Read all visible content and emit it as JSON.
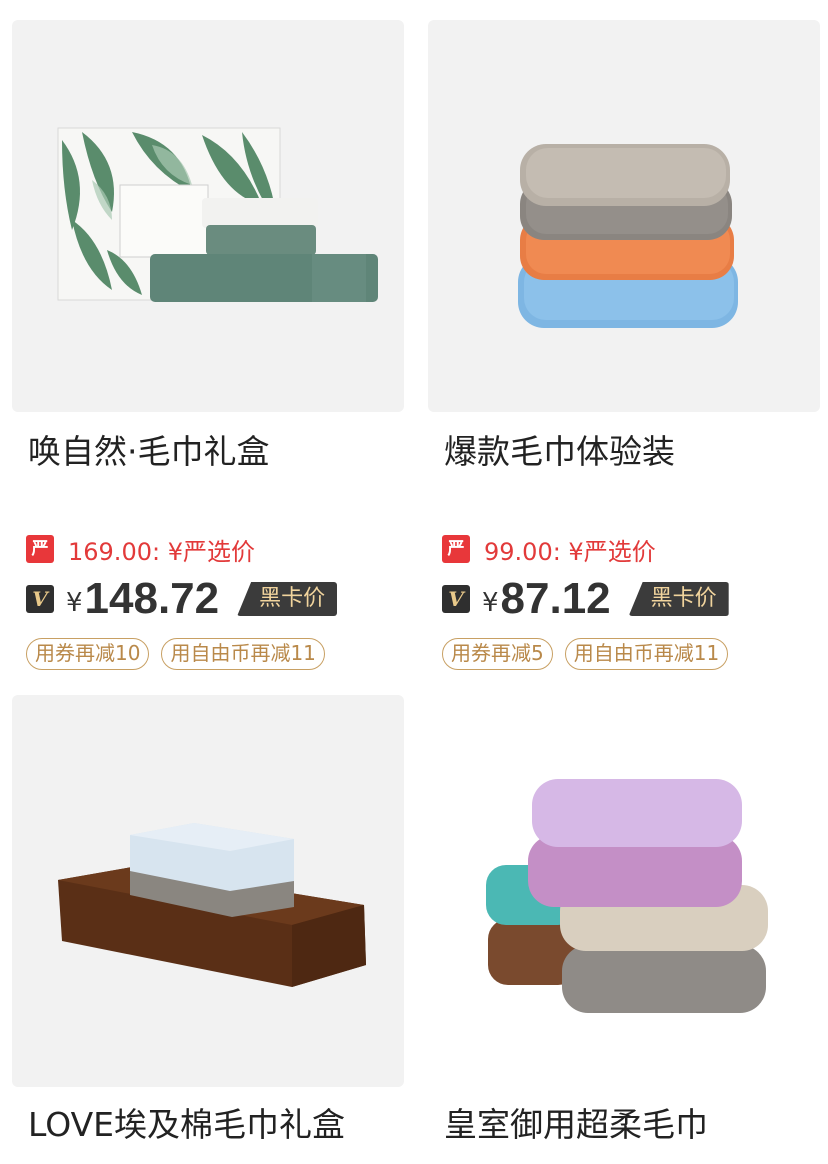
{
  "products": [
    {
      "title": "唤自然·毛巾礼盒",
      "yanxuan_icon": "严",
      "yanxuan_price": "169.00: ¥严选价",
      "vip_icon": "V",
      "currency": "¥",
      "black_card_price": "148.72",
      "black_card_label": "黑卡价",
      "coupons": [
        "用券再减10",
        "用自由币再减11"
      ]
    },
    {
      "title": "爆款毛巾体验装",
      "yanxuan_icon": "严",
      "yanxuan_price": "99.00: ¥严选价",
      "vip_icon": "V",
      "currency": "¥",
      "black_card_price": "87.12",
      "black_card_label": "黑卡价",
      "coupons": [
        "用券再减5",
        "用自由币再减11"
      ]
    },
    {
      "title": "LOVE埃及棉毛巾礼盒"
    },
    {
      "title": "皇室御用超柔毛巾"
    }
  ],
  "colors": {
    "yanxuan_red": "#e23a3a",
    "black_card_bg": "#3b3b3b",
    "black_card_text": "#f1d49d",
    "coupon_border": "#c8a063"
  },
  "images": [
    "towel-gift-box-image",
    "stacked-towels-image",
    "egyptian-cotton-towel-set-image",
    "soft-towel-pile-image"
  ]
}
